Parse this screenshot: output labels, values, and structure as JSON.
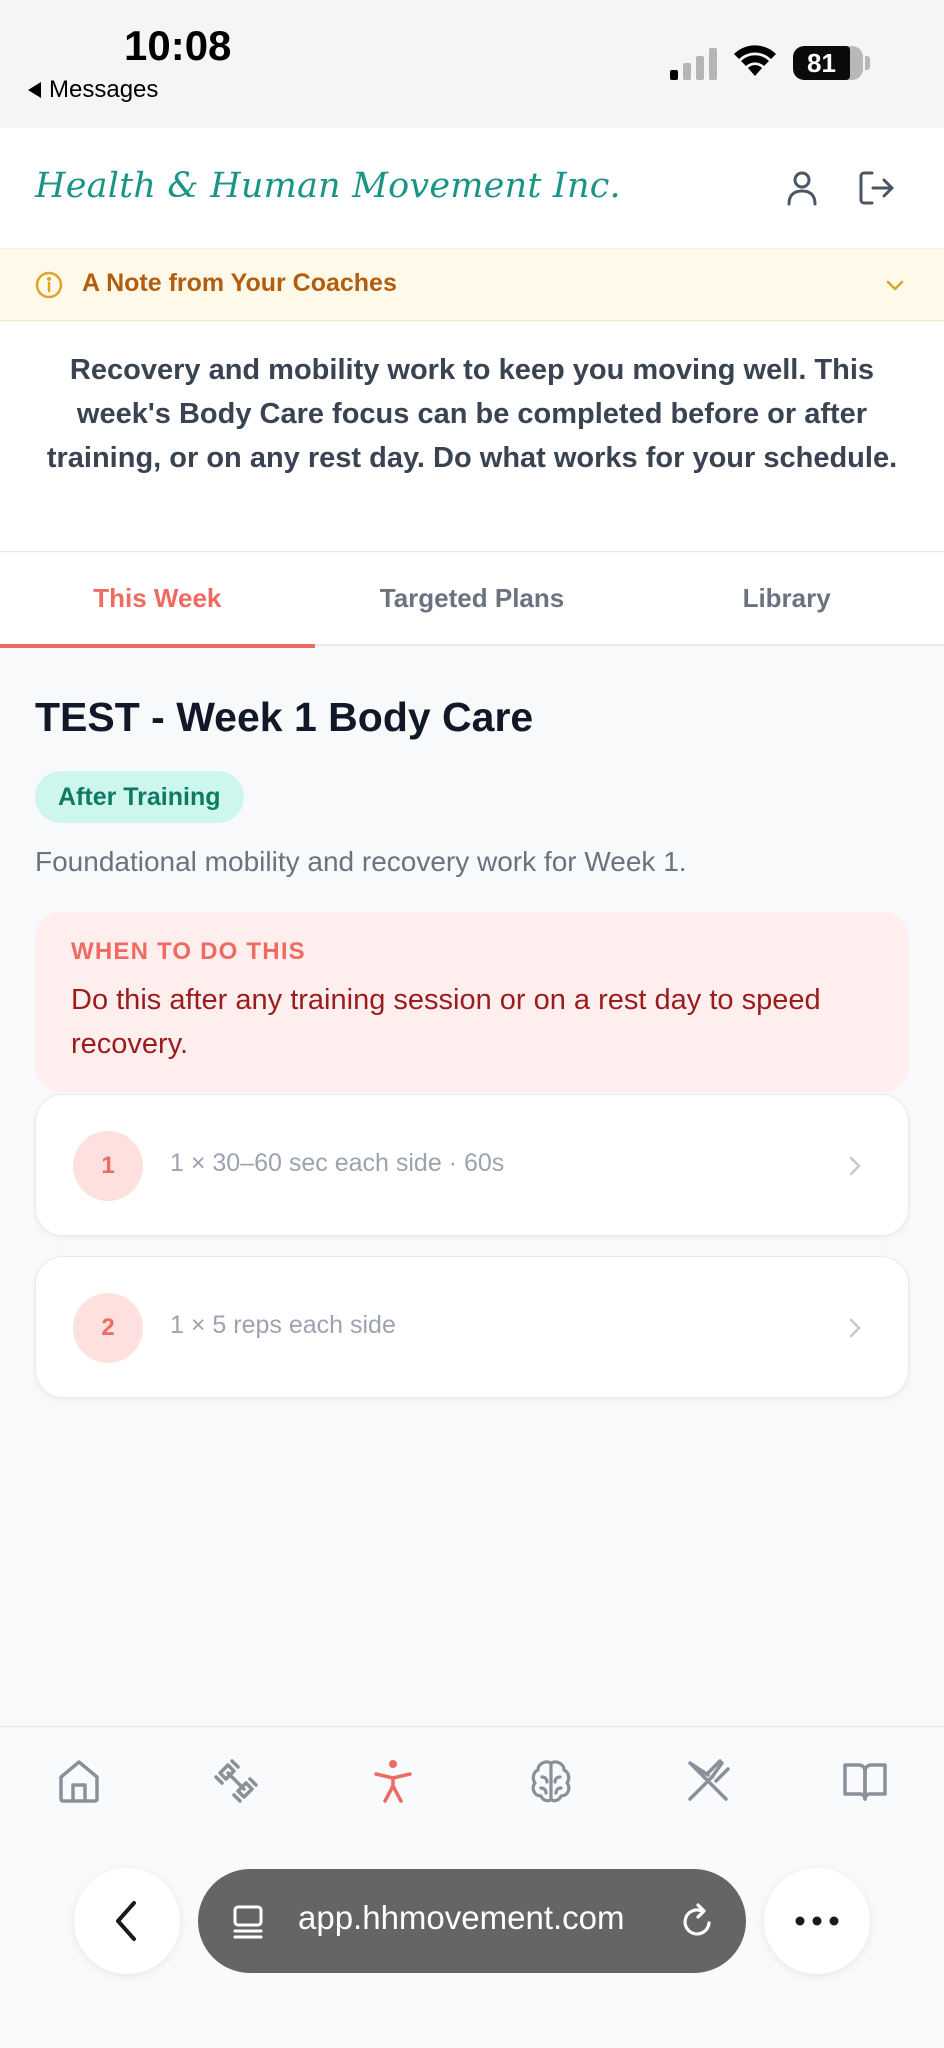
{
  "status_bar": {
    "time": "10:08",
    "back_app": "Messages",
    "battery": "81",
    "battery_level": 0.81
  },
  "header": {
    "brand": "Health & Human Movement Inc.",
    "icons": [
      "user-icon",
      "logout-icon"
    ],
    "brand_color": "#1a9485"
  },
  "coach_note": {
    "title": "A Note from Your Coaches",
    "icon": "info-icon",
    "expanded": false
  },
  "intro": {
    "text": "Recovery and mobility work to keep you moving well. This week's Body Care focus can be completed before or after training, or on any rest day. Do what works for your schedule."
  },
  "tabs": [
    {
      "label": "This Week",
      "active": true
    },
    {
      "label": "Targeted Plans",
      "active": false
    },
    {
      "label": "Library",
      "active": false
    }
  ],
  "main": {
    "title": "TEST - Week 1 Body Care",
    "tag": "After Training",
    "subtitle": "Foundational mobility and recovery work for Week 1.",
    "when": {
      "label": "WHEN TO DO THIS",
      "text": "Do this after any training session or on a rest day to speed recovery."
    },
    "exercises": [
      {
        "number": "1",
        "detail": "1 × 30–60 sec each side · 60s"
      },
      {
        "number": "2",
        "detail": "1 × 5 reps each side"
      }
    ]
  },
  "bottom_nav": {
    "items": [
      "home-icon",
      "dumbbell-icon",
      "body-care-icon",
      "brain-icon",
      "nutrition-icon",
      "library-icon"
    ],
    "active": "body-care-icon",
    "accent": "#ef6b61"
  },
  "browser": {
    "url": "app.hhmovement.com"
  }
}
